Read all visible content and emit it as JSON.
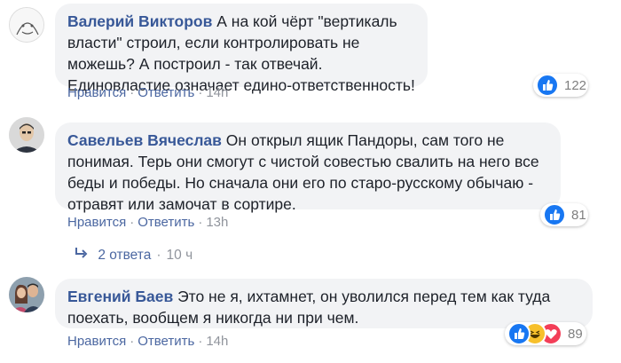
{
  "comments": [
    {
      "author": "Валерий Викторов",
      "text": " А на кой чёрт \"вертикаль власти\" строил, если контролировать не можешь? А построил - так отвечай. Единовластие означает едино-ответственность!",
      "like_label": "Нравится",
      "reply_label": "Ответить",
      "time": "14h",
      "reaction_count": "122",
      "reaction_icons": [
        "like-icon"
      ]
    },
    {
      "author": "Савельев Вячеслав",
      "text": " Он открыл ящик Пандоры, сам того не понимая. Терь они смогут с чистой совестью свалить на него все беды и победы. Но сначала они его по старо-русскому обычаю - отравят или замочат в сортире.",
      "like_label": "Нравится",
      "reply_label": "Ответить",
      "time": "13h",
      "reaction_count": "81",
      "reaction_icons": [
        "like-icon"
      ],
      "replies_label": "2 ответа",
      "replies_time": "10 ч"
    },
    {
      "author": "Евгений Баев",
      "text": " Это не я, ихтамнет, он уволился перед тем как туда поехать, вообщем я никогда ни при чем.",
      "like_label": "Нравится",
      "reply_label": "Ответить",
      "time": "14h",
      "reaction_count": "89",
      "reaction_icons": [
        "like-icon",
        "haha-icon",
        "love-icon"
      ]
    }
  ],
  "colors": {
    "author": "#385898",
    "bubble": "#f2f3f5",
    "like": "#1877f2",
    "haha": "#f7c02b",
    "love": "#f33e58"
  }
}
